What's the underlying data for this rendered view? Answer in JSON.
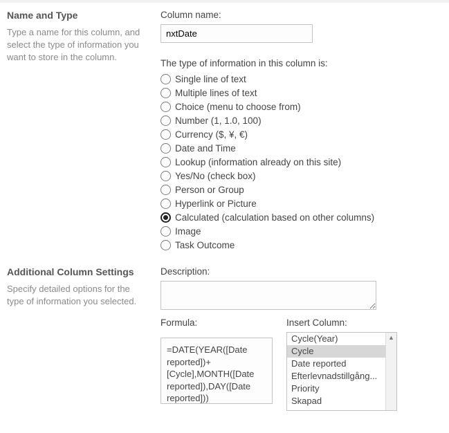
{
  "name_type": {
    "title": "Name and Type",
    "desc": "Type a name for this column, and select the type of information you want to store in the column.",
    "column_name_label": "Column name:",
    "column_name_value": "nxtDate",
    "type_prompt": "The type of information in this column is:",
    "types": [
      {
        "label": "Single line of text",
        "selected": false
      },
      {
        "label": "Multiple lines of text",
        "selected": false
      },
      {
        "label": "Choice (menu to choose from)",
        "selected": false
      },
      {
        "label": "Number (1, 1.0, 100)",
        "selected": false
      },
      {
        "label": "Currency ($, ¥, €)",
        "selected": false
      },
      {
        "label": "Date and Time",
        "selected": false
      },
      {
        "label": "Lookup (information already on this site)",
        "selected": false
      },
      {
        "label": "Yes/No (check box)",
        "selected": false
      },
      {
        "label": "Person or Group",
        "selected": false
      },
      {
        "label": "Hyperlink or Picture",
        "selected": false
      },
      {
        "label": "Calculated (calculation based on other columns)",
        "selected": true
      },
      {
        "label": "Image",
        "selected": false
      },
      {
        "label": "Task Outcome",
        "selected": false
      }
    ]
  },
  "additional": {
    "title": "Additional Column Settings",
    "desc": "Specify detailed options for the type of information you selected.",
    "description_label": "Description:",
    "description_value": "",
    "formula_label": "Formula:",
    "formula_value": "=DATE(YEAR([Date reported])+[Cycle],MONTH([Date reported]),DAY([Date reported]))",
    "insert_label": "Insert Column:",
    "insert_columns": [
      {
        "label": "Cycle(Year)",
        "selected": false
      },
      {
        "label": "Cycle",
        "selected": true
      },
      {
        "label": "Date reported",
        "selected": false
      },
      {
        "label": "Efterlevnadstillgång...",
        "selected": false
      },
      {
        "label": "Priority",
        "selected": false
      },
      {
        "label": "Skapad",
        "selected": false
      }
    ]
  }
}
